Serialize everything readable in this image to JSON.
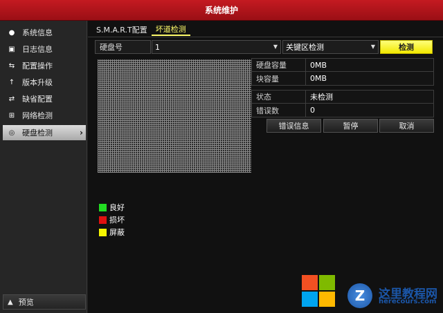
{
  "window": {
    "title": "系统维护"
  },
  "sidebar": {
    "items": [
      {
        "label": "系统信息",
        "icon": "info-icon"
      },
      {
        "label": "日志信息",
        "icon": "log-icon"
      },
      {
        "label": "配置操作",
        "icon": "config-icon"
      },
      {
        "label": "版本升级",
        "icon": "upgrade-icon"
      },
      {
        "label": "缺省配置",
        "icon": "default-icon"
      },
      {
        "label": "网络检测",
        "icon": "network-icon"
      },
      {
        "label": "硬盘检测",
        "icon": "disk-check-icon",
        "active": true
      }
    ],
    "preview_label": "预览"
  },
  "tabs": [
    {
      "label": "S.M.A.R.T配置"
    },
    {
      "label": "坏道检测",
      "active": true
    }
  ],
  "form": {
    "disk_label": "硬盘号",
    "disk_value": "1",
    "mode_value": "关键区检测",
    "check_button": "检测"
  },
  "info_top": [
    {
      "key": "硬盘容量",
      "value": "0MB"
    },
    {
      "key": "块容量",
      "value": "0MB"
    }
  ],
  "info_status": [
    {
      "key": "状态",
      "value": "未检测"
    },
    {
      "key": "错误数",
      "value": "0"
    }
  ],
  "actions": {
    "error_info": "错误信息",
    "pause": "暂停",
    "cancel": "取消"
  },
  "legend": [
    {
      "label": "良好",
      "color": "#22dd22"
    },
    {
      "label": "损坏",
      "color": "#e01010"
    },
    {
      "label": "屏蔽",
      "color": "#f5f500"
    }
  ],
  "watermark": {
    "cn": "这里教程网",
    "en": "herecours.com"
  },
  "colors": {
    "title_red": "#c41a21",
    "accent_yellow": "#fffc6a"
  }
}
